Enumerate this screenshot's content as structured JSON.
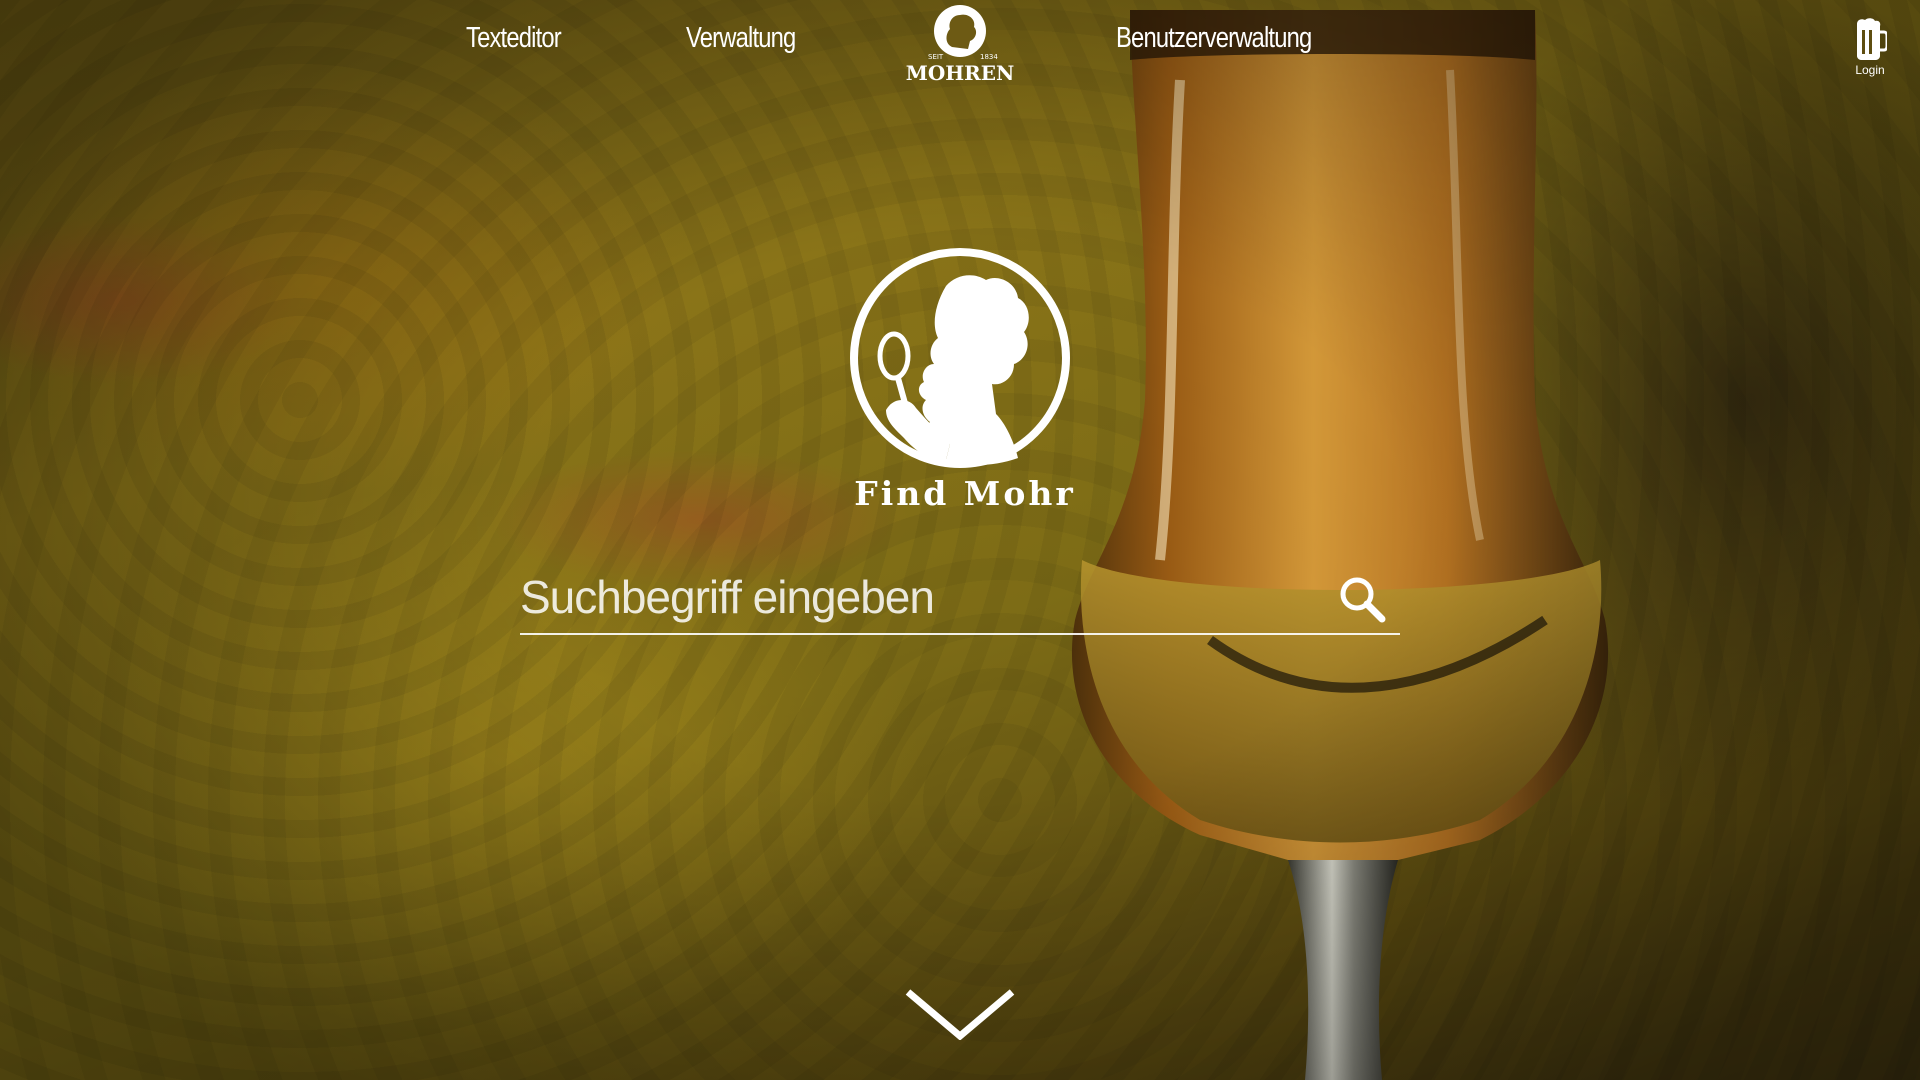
{
  "nav": {
    "items": [
      {
        "label": "Texteditor"
      },
      {
        "label": "Verwaltung"
      },
      {
        "label": "Benutzerverwaltung"
      }
    ],
    "brand": {
      "name": "MOHREN",
      "since_left": "SEIT",
      "since_right": "1834"
    },
    "login": {
      "label": "Login",
      "icon": "beer-mug-icon"
    }
  },
  "hero": {
    "title": "Find Mohr",
    "icon": "mohr-magnifier-logo"
  },
  "search": {
    "placeholder": "Suchbegriff eingeben",
    "value": "",
    "icon": "search-icon"
  },
  "scroll": {
    "icon": "chevron-down-icon"
  },
  "colors": {
    "text": "#ffffff",
    "background_tone": "#7d6c16",
    "beer": "#c88a1e"
  }
}
